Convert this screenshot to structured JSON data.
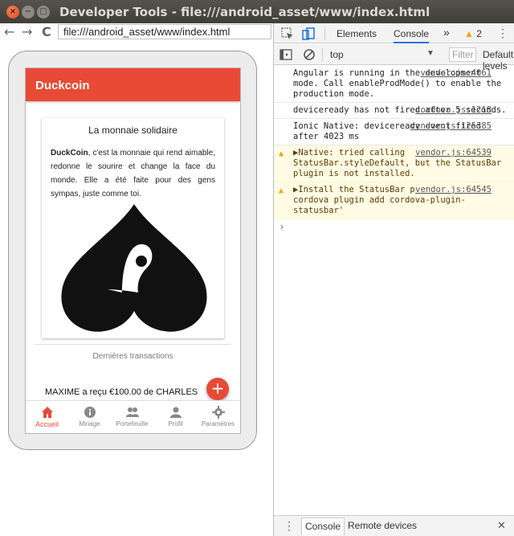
{
  "window": {
    "title": "Developer Tools - file:///android_asset/www/index.html",
    "close_glyph": "×",
    "min_glyph": "−",
    "max_glyph": "□"
  },
  "browser": {
    "back_glyph": "←",
    "forward_glyph": "→",
    "reload_glyph": "C",
    "url": "file:///android_asset/www/index.html"
  },
  "app": {
    "title": "Duckcoin",
    "card_title": "La monnaie solidaire",
    "card_text_bold": "DuckCoin",
    "card_text": ", c'est la monnaie qui rend aimable, redonne le sourire et change la face du monde. Elle a été faite pour des gens sympas, juste comme toi.",
    "section_label": "Dernières transactions",
    "transaction": "MAXIME a reçu €100.00 de CHARLES",
    "fab_glyph": "+",
    "tabs": [
      {
        "label": "Accueil",
        "icon": "home-icon",
        "active": true
      },
      {
        "label": "Minage",
        "icon": "info-icon",
        "active": false
      },
      {
        "label": "Portefeuille",
        "icon": "people-icon",
        "active": false
      },
      {
        "label": "Profil",
        "icon": "person-icon",
        "active": false
      },
      {
        "label": "Paramètres",
        "icon": "gear-icon",
        "active": false
      }
    ],
    "colors": {
      "accent": "#e84a36"
    }
  },
  "devtools": {
    "tabs": {
      "elements": "Elements",
      "console": "Console",
      "more": "»"
    },
    "warning_count": "2",
    "warning_glyph": "▲",
    "kebab_glyph": "⋮",
    "context": "top",
    "context_arrow": "▼",
    "filter_placeholder": "Filter",
    "levels": "Default levels",
    "messages": [
      {
        "level": "log",
        "text": "Angular is running in the development mode. Call enableProdMode() to enable the production mode.",
        "source": "vendor.js:4061"
      },
      {
        "level": "log",
        "text": "deviceready has not fired after 5 seconds.",
        "source": "cordova.js:1218"
      },
      {
        "level": "log",
        "text": "Ionic Native: deviceready event fired after 4023 ms",
        "source": "vendor.js:125385"
      },
      {
        "level": "warn",
        "text": "▶Native: tried calling StatusBar.styleDefault, but the StatusBar plugin is not installed.",
        "source": "vendor.js:64539"
      },
      {
        "level": "warn",
        "text": "▶Install the StatusBar plugin: 'ionic cordova plugin add cordova-plugin-statusbar'",
        "source": "vendor.js:64545"
      }
    ],
    "prompt_glyph": "›",
    "drawer": {
      "kebab": "⋮",
      "console": "Console",
      "remote": "Remote devices",
      "close": "✕"
    }
  }
}
